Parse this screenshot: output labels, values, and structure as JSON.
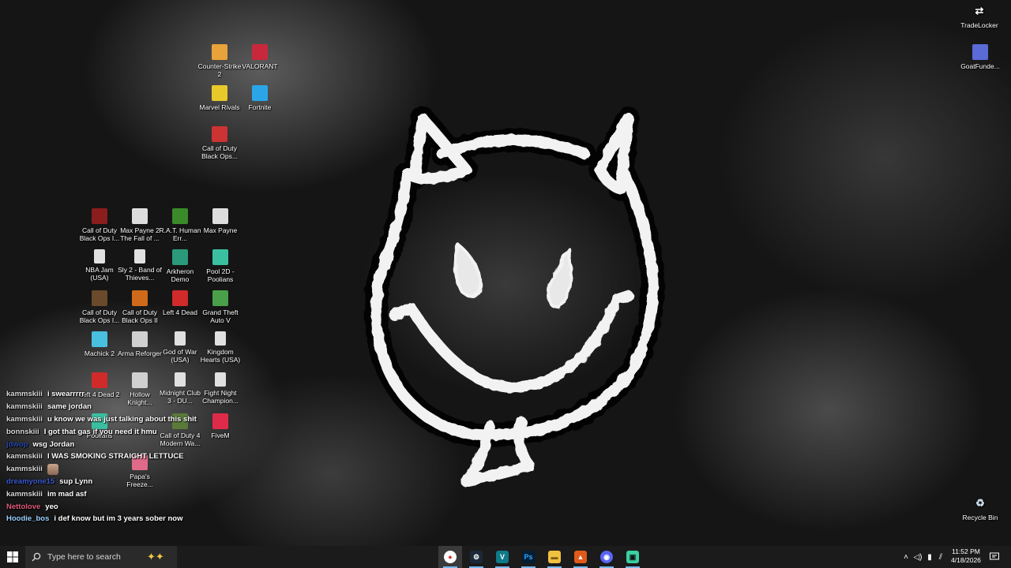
{
  "desktop": {
    "icons": [
      {
        "label": "Counter-Strike 2",
        "icon": "counter-strike-icon",
        "color": "#e8a33a"
      },
      {
        "label": "VALORANT",
        "icon": "valorant-icon",
        "color": "#c8283c"
      },
      {
        "label": "Marvel Rivals",
        "icon": "marvel-rivals-icon",
        "color": "#e8c92a"
      },
      {
        "label": "Fortnite",
        "icon": "fortnite-icon",
        "color": "#2aa6e8"
      },
      {
        "label": "Call of Duty Black Ops...",
        "icon": "call-of-duty-icon",
        "color": "#cc3333"
      },
      {
        "label": "TradeLocker",
        "icon": "tradelocker-icon",
        "color": "#ffffff"
      },
      {
        "label": "GoatFunde...",
        "icon": "goatfunded-icon",
        "color": "#5a6ad6"
      },
      {
        "label": "Call of Duty Black Ops I...",
        "icon": "call-of-duty-icon",
        "color": "#8b1d1d"
      },
      {
        "label": "Max Payne 2 The Fall of ...",
        "icon": "max-payne-icon",
        "color": "#dddddd"
      },
      {
        "label": "R.A.T. Human Err...",
        "icon": "rat-icon",
        "color": "#3a8a2a"
      },
      {
        "label": "Max Payne",
        "icon": "max-payne-icon",
        "color": "#dddddd"
      },
      {
        "label": "NBA Jam (USA)",
        "icon": "file-icon",
        "color": "#e0e0e0"
      },
      {
        "label": "Sly 2 - Band of Thieves...",
        "icon": "file-icon",
        "color": "#e0e0e0"
      },
      {
        "label": "Arkheron Demo",
        "icon": "arkheron-icon",
        "color": "#2a9a7a"
      },
      {
        "label": "Pool 2D - Poolians",
        "icon": "pool-icon",
        "color": "#3ac0a0"
      },
      {
        "label": "Call of Duty Black Ops I...",
        "icon": "call-of-duty-icon",
        "color": "#6a4a2a"
      },
      {
        "label": "Call of Duty Black Ops II",
        "icon": "call-of-duty-icon",
        "color": "#d06a1a"
      },
      {
        "label": "Left 4 Dead",
        "icon": "left-4-dead-icon",
        "color": "#d02a2a"
      },
      {
        "label": "Grand Theft Auto V",
        "icon": "gta-icon",
        "color": "#4aa04a"
      },
      {
        "label": "Machick 2",
        "icon": "machick-icon",
        "color": "#4ac0e0"
      },
      {
        "label": "Arma Reforger",
        "icon": "arma-icon",
        "color": "#d0d0d0"
      },
      {
        "label": "God of War (USA)",
        "icon": "file-icon",
        "color": "#e0e0e0"
      },
      {
        "label": "Kingdom Hearts (USA)",
        "icon": "file-icon",
        "color": "#e0e0e0"
      },
      {
        "label": "Left 4 Dead 2",
        "icon": "left-4-dead-icon",
        "color": "#d02a2a"
      },
      {
        "label": "Hollow Knight...",
        "icon": "hollow-knight-icon",
        "color": "#d0d0d0"
      },
      {
        "label": "Midnight Club 3 - DU...",
        "icon": "file-icon",
        "color": "#e0e0e0"
      },
      {
        "label": "Fight Night Champion...",
        "icon": "file-icon",
        "color": "#e0e0e0"
      },
      {
        "label": "Poolians",
        "icon": "pool-icon",
        "color": "#3ac0a0"
      },
      {
        "label": "Call of Duty 4 Modern Wa...",
        "icon": "call-of-duty-icon",
        "color": "#5a7a3a"
      },
      {
        "label": "FiveM",
        "icon": "fivem-icon",
        "color": "#e02a4a"
      },
      {
        "label": "Papa's Freeze...",
        "icon": "papas-icon",
        "color": "#e06a8a"
      },
      {
        "label": "Recycle Bin",
        "icon": "recycle-bin-icon",
        "color": "#cfe0f0"
      }
    ]
  },
  "chat": {
    "messages": [
      {
        "user": "kammskiii",
        "text": "i swearrrrr",
        "color": "#d8d8d8"
      },
      {
        "user": "kammskiii",
        "text": "same jordan",
        "color": "#d8d8d8"
      },
      {
        "user": "kammskiii",
        "text": "u know we was just talking about this shit",
        "color": "#d8d8d8"
      },
      {
        "user": "bonnskiii",
        "text": "I got that gas if you need it hmu",
        "color": "#d8d8d8"
      },
      {
        "user": "jdwop",
        "text": "wsg Jordan",
        "color": "#2a4ab0"
      },
      {
        "user": "kammskiii",
        "text": "I WAS SMOKING STRAIGHT LETTUCE",
        "color": "#d8d8d8"
      },
      {
        "user": "kammskiii",
        "text": "",
        "color": "#d8d8d8",
        "emote": true
      },
      {
        "user": "dreamyone15",
        "text": "sup Lynn",
        "color": "#3a5ad0"
      },
      {
        "user": "kammskiii",
        "text": "im mad asf",
        "color": "#d8d8d8"
      },
      {
        "user": "Nettolove",
        "text": "yeo",
        "color": "#e05a7a"
      },
      {
        "user": "Hoodie_bos",
        "text": "i def know but im 3 years sober now",
        "color": "#9ad0ff"
      }
    ]
  },
  "taskbar": {
    "search_placeholder": "Type here to search",
    "apps": [
      {
        "name": "chrome",
        "glyph": "●"
      },
      {
        "name": "steam",
        "glyph": "⚙"
      },
      {
        "name": "vscode",
        "glyph": "V"
      },
      {
        "name": "photoshop",
        "glyph": "Ps"
      },
      {
        "name": "file-explorer",
        "glyph": "▬"
      },
      {
        "name": "brave",
        "glyph": "▲"
      },
      {
        "name": "discord",
        "glyph": "◉"
      },
      {
        "name": "game-app",
        "glyph": "▣"
      }
    ],
    "time": "11:52 PM",
    "date": "4/18/2026"
  }
}
